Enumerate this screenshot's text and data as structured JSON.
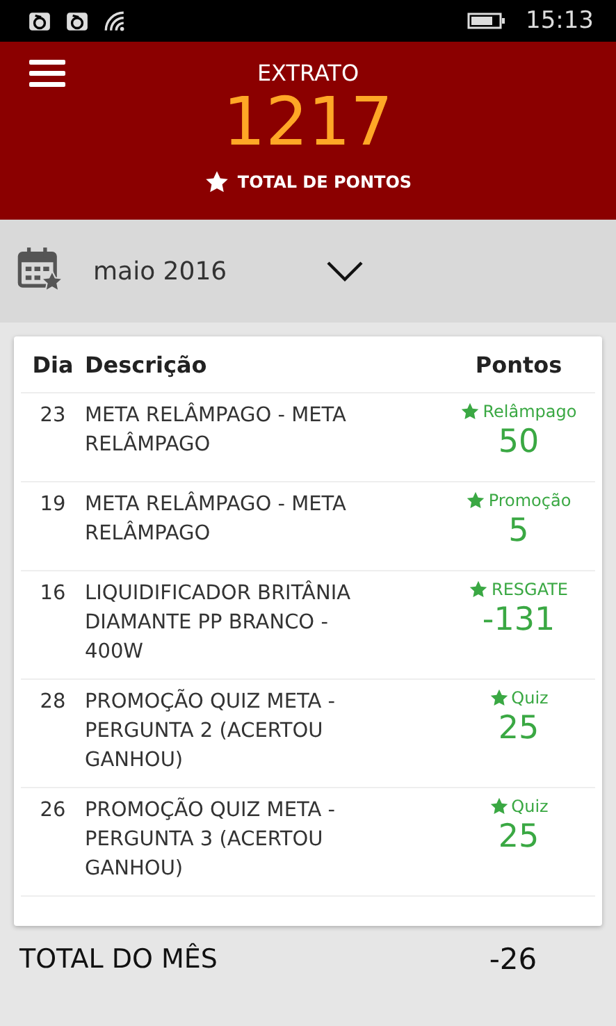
{
  "status_bar": {
    "time": "15:13"
  },
  "header": {
    "title": "EXTRATO",
    "points": "1217",
    "points_label": "TOTAL DE PONTOS"
  },
  "month_picker": {
    "value": "maio 2016"
  },
  "table": {
    "columns": [
      "Dia",
      "Descrição",
      "Pontos"
    ],
    "rows": [
      {
        "day": "23",
        "description": "META RELÂMPAGO - META RELÂMPAGO",
        "category": "Relâmpago",
        "points": "50"
      },
      {
        "day": "19",
        "description": "META RELÂMPAGO - META RELÂMPAGO",
        "category": "Promoção",
        "points": "5"
      },
      {
        "day": "16",
        "description": "LIQUIDIFICADOR BRITÂNIA DIAMANTE PP BRANCO - 400W",
        "category": "RESGATE",
        "points": "-131"
      },
      {
        "day": "28",
        "description": "PROMOÇÃO QUIZ META - PERGUNTA 2 (ACERTOU GANHOU)",
        "category": "Quiz",
        "points": "25"
      },
      {
        "day": "26",
        "description": "PROMOÇÃO QUIZ META - PERGUNTA 3 (ACERTOU GANHOU)",
        "category": "Quiz",
        "points": "25"
      }
    ]
  },
  "month_total": {
    "label": "TOTAL DO MÊS",
    "value": "-26"
  }
}
